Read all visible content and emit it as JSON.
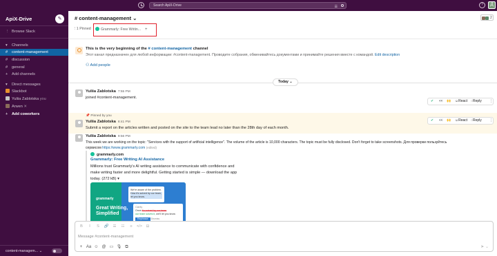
{
  "topbar": {
    "search_placeholder": "Search ApiX-Drive",
    "help_icon": "?",
    "user_initial": "Д"
  },
  "sidebar": {
    "workspace": "ApiX-Drive",
    "browse": "Browse Slack",
    "channels_header": "Channels",
    "channels": [
      "content-management",
      "discussion",
      "general"
    ],
    "add_channels": "Add channels",
    "dm_header": "Direct messages",
    "dms": [
      {
        "name": "Slackbot",
        "suffix": ""
      },
      {
        "name": "Yuliia Zablotska",
        "suffix": "you"
      },
      {
        "name": "Arwen",
        "suffix": "✕"
      }
    ],
    "add_coworkers": "Add coworkers",
    "footer_label": "content-managem... ⌄"
  },
  "channel": {
    "title": "# content-management ⌄",
    "member_count": "2",
    "pinned": "1 Pinned",
    "bookmark": "Grammarly: Free Writin...",
    "bookmark_add": "+",
    "intro_prefix": "This is the very beginning of the ",
    "intro_channel": "# content-management",
    "intro_suffix": " channel",
    "intro_desc": "Этот канал предназначен для любой информации: #content-management. Проводите собрания, обменивайтесь документами и принимайте решения вместе с командой. ",
    "intro_edit": "Edit description",
    "add_people": "Add people",
    "date_divider": "Today ⌄"
  },
  "messages": [
    {
      "author": "Yuliia Zablotska",
      "time": "7:55 PM",
      "text": "joined #content-management."
    },
    {
      "author": "Yuliia Zablotska",
      "time": "8:41 PM",
      "text": "Submit a report on the articles written and posted on the site to the team lead no later than the 28th day of each month.",
      "pinned_by": "Pinned by you"
    },
    {
      "author": "Yuliia Zablotska",
      "time": "9:56 PM",
      "line1": "This week we are working on the topic: \"Services with the support of artificial intelligence\". The volume of the article is 10,000 characters. The topic must be fully disclosed. Don't forget to take screenshots. Для проверки пользуйтесь",
      "line2_prefix": "сервисом ",
      "line2_link": "https://www.grammarly.com",
      "line2_edited": "(edited)"
    }
  ],
  "actions": {
    "check": "✔",
    "eyes": "👀",
    "hands": "🙌",
    "react": "React",
    "reply": "Reply",
    "more": "⋮"
  },
  "unfurl": {
    "source": "grammarly.com",
    "title": "Grammarly: Free Writing AI Assistance",
    "desc": "Millions trust Grammarly's AI writing assistance to communicate with confidence and make writing faster and more delightful. Getting started is simple — download the app today. (272 kB) ▾",
    "preview": {
      "brand": "grammarly",
      "headline": "Great Writing, Simplified",
      "card1_a": "We're aware of the problem.",
      "card1_b": "How it's solved by our team,",
      "card1_c": "let you know.",
      "card2_label": "Clarity",
      "card2_a": "Once",
      "card2_strike": "it's solved by our team",
      "card2_b": "our team solves it",
      "card2_c": ", we'll let you know",
      "card2_btn": "Rephrase",
      "card2_dismiss": "Dismiss"
    }
  },
  "composer": {
    "placeholder": "Message #content-management",
    "format_icons": [
      "B",
      "I",
      "S",
      "🔗",
      "☰",
      "☷",
      "≡",
      "</>",
      "⊟"
    ],
    "attach_icons": [
      "+",
      "Aa",
      "☺",
      "@",
      "▭",
      "🎙",
      "⧉"
    ],
    "send": "➤ ⌄"
  },
  "colors": {
    "sidebar": "#3f0e40",
    "active": "#1164a3",
    "link": "#1264a3",
    "highlight": "#e01e2a"
  }
}
